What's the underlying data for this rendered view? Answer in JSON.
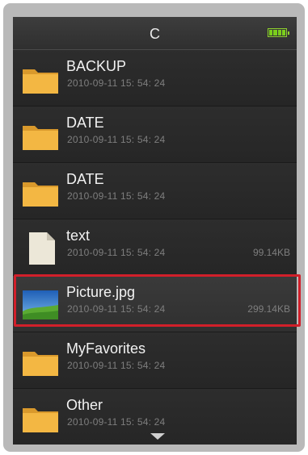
{
  "header": {
    "title": "C"
  },
  "battery": {
    "icon": "battery-icon",
    "level": 1.0,
    "color": "#7bcf1c"
  },
  "files": [
    {
      "name": "BACKUP",
      "date": "2010-09-11 15: 54: 24",
      "size": "",
      "icon": "folder-icon"
    },
    {
      "name": "DATE",
      "date": "2010-09-11 15: 54: 24",
      "size": "",
      "icon": "folder-icon"
    },
    {
      "name": "DATE",
      "date": "2010-09-11 15: 54: 24",
      "size": "",
      "icon": "folder-icon"
    },
    {
      "name": "text",
      "date": "2010-09-11 15: 54: 24",
      "size": "99.14KB",
      "icon": "text-file-icon"
    },
    {
      "name": "Picture.jpg",
      "date": "2010-09-11 15: 54: 24",
      "size": "299.14KB",
      "icon": "image-file-icon",
      "selected": true
    },
    {
      "name": "MyFavorites",
      "date": "2010-09-11 15: 54: 24",
      "size": "",
      "icon": "folder-icon"
    },
    {
      "name": "Other",
      "date": "2010-09-11 15: 54: 24",
      "size": "",
      "icon": "folder-icon"
    }
  ],
  "colors": {
    "highlight": "#d11f2a",
    "folder": "#f0b43a",
    "screen": "#262626"
  },
  "footer": {
    "icon": "scroll-down-arrow-icon"
  }
}
